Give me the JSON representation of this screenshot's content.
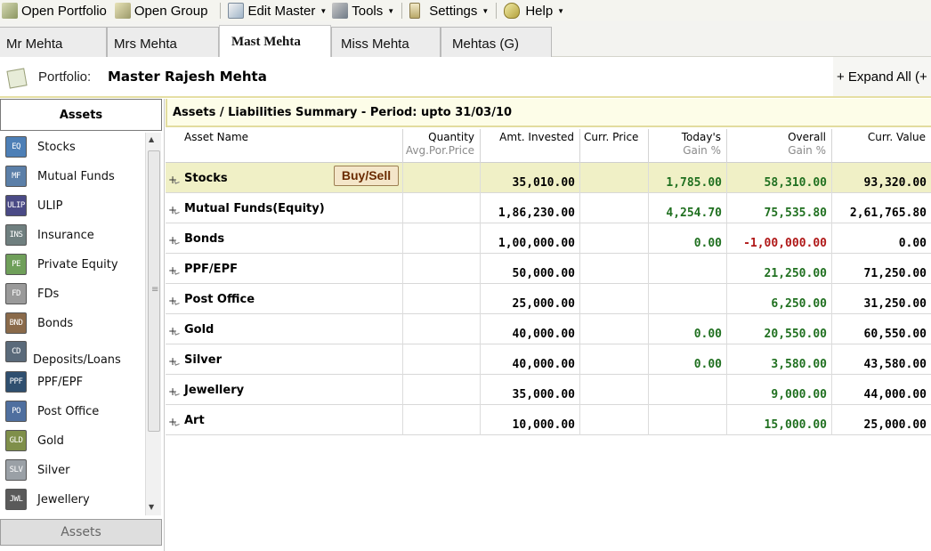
{
  "toolbar": {
    "open_portfolio": "Open Portfolio",
    "open_group": "Open Group",
    "edit_master": "Edit Master",
    "tools": "Tools",
    "settings": "Settings",
    "help": "Help"
  },
  "tabs": [
    "Mr Mehta",
    "Mrs Mehta",
    "Mast Mehta",
    "Miss Mehta",
    "Mehtas (G)"
  ],
  "active_tab": "Mast Mehta",
  "portfolio": {
    "label": "Portfolio:",
    "name": "Master Rajesh Mehta",
    "expand_all": "+ Expand All (+"
  },
  "sidebar": {
    "header": "Assets",
    "footer": "Assets",
    "items": [
      {
        "code": "EQ",
        "label": "Stocks",
        "color": "#4d7fb6"
      },
      {
        "code": "MF",
        "label": "Mutual Funds",
        "color": "#5b7fa8"
      },
      {
        "code": "ULIP",
        "label": "ULIP",
        "color": "#4a4a86"
      },
      {
        "code": "INS",
        "label": "Insurance",
        "color": "#6f7f7f"
      },
      {
        "code": "PE",
        "label": "Private Equity",
        "color": "#6f9f5a"
      },
      {
        "code": "FD",
        "label": "FDs",
        "color": "#9a9a9a"
      },
      {
        "code": "BND",
        "label": "Bonds",
        "color": "#8a6a4a"
      },
      {
        "code": "CD",
        "label": "Deposits/Loans",
        "color": "#5a6a7a"
      },
      {
        "code": "PPF",
        "label": "PPF/EPF",
        "color": "#2f4f6f"
      },
      {
        "code": "PO",
        "label": "Post Office",
        "color": "#4f6f9f"
      },
      {
        "code": "GLD",
        "label": "Gold",
        "color": "#7f8f4a"
      },
      {
        "code": "SLV",
        "label": "Silver",
        "color": "#9aa0a6"
      },
      {
        "code": "JWL",
        "label": "Jewellery",
        "color": "#5a5a5a"
      }
    ]
  },
  "summary": {
    "title": "Assets / Liabilities Summary -  Period:  upto 31/03/10"
  },
  "table": {
    "headers": {
      "asset_name": "Asset Name",
      "quantity": "Quantity",
      "quantity_sub": "Avg.Por.Price",
      "amt_invested": "Amt. Invested",
      "curr_price": "Curr. Price",
      "todays": "Today's",
      "todays_sub": "Gain %",
      "overall": "Overall",
      "overall_sub": "Gain %",
      "curr_value": "Curr.  Value"
    },
    "buy_sell_label": "Buy/Sell",
    "rows": [
      {
        "name": "Stocks",
        "invested": "35,010.00",
        "todays": "1,785.00",
        "overall": "58,310.00",
        "value": "93,320.00",
        "overall_sign": "pos"
      },
      {
        "name": "Mutual Funds(Equity)",
        "invested": "1,86,230.00",
        "todays": "4,254.70",
        "overall": "75,535.80",
        "value": "2,61,765.80",
        "overall_sign": "pos"
      },
      {
        "name": "Bonds",
        "invested": "1,00,000.00",
        "todays": "0.00",
        "overall": "-1,00,000.00",
        "value": "0.00",
        "overall_sign": "neg"
      },
      {
        "name": "PPF/EPF",
        "invested": "50,000.00",
        "todays": "",
        "overall": "21,250.00",
        "value": "71,250.00",
        "overall_sign": "pos"
      },
      {
        "name": "Post Office",
        "invested": "25,000.00",
        "todays": "",
        "overall": "6,250.00",
        "value": "31,250.00",
        "overall_sign": "pos"
      },
      {
        "name": "Gold",
        "invested": "40,000.00",
        "todays": "0.00",
        "overall": "20,550.00",
        "value": "60,550.00",
        "overall_sign": "pos"
      },
      {
        "name": "Silver",
        "invested": "40,000.00",
        "todays": "0.00",
        "overall": "3,580.00",
        "value": "43,580.00",
        "overall_sign": "pos"
      },
      {
        "name": "Jewellery",
        "invested": "35,000.00",
        "todays": "",
        "overall": "9,000.00",
        "value": "44,000.00",
        "overall_sign": "pos"
      },
      {
        "name": "Art",
        "invested": "10,000.00",
        "todays": "",
        "overall": "15,000.00",
        "value": "25,000.00",
        "overall_sign": "pos"
      }
    ]
  }
}
